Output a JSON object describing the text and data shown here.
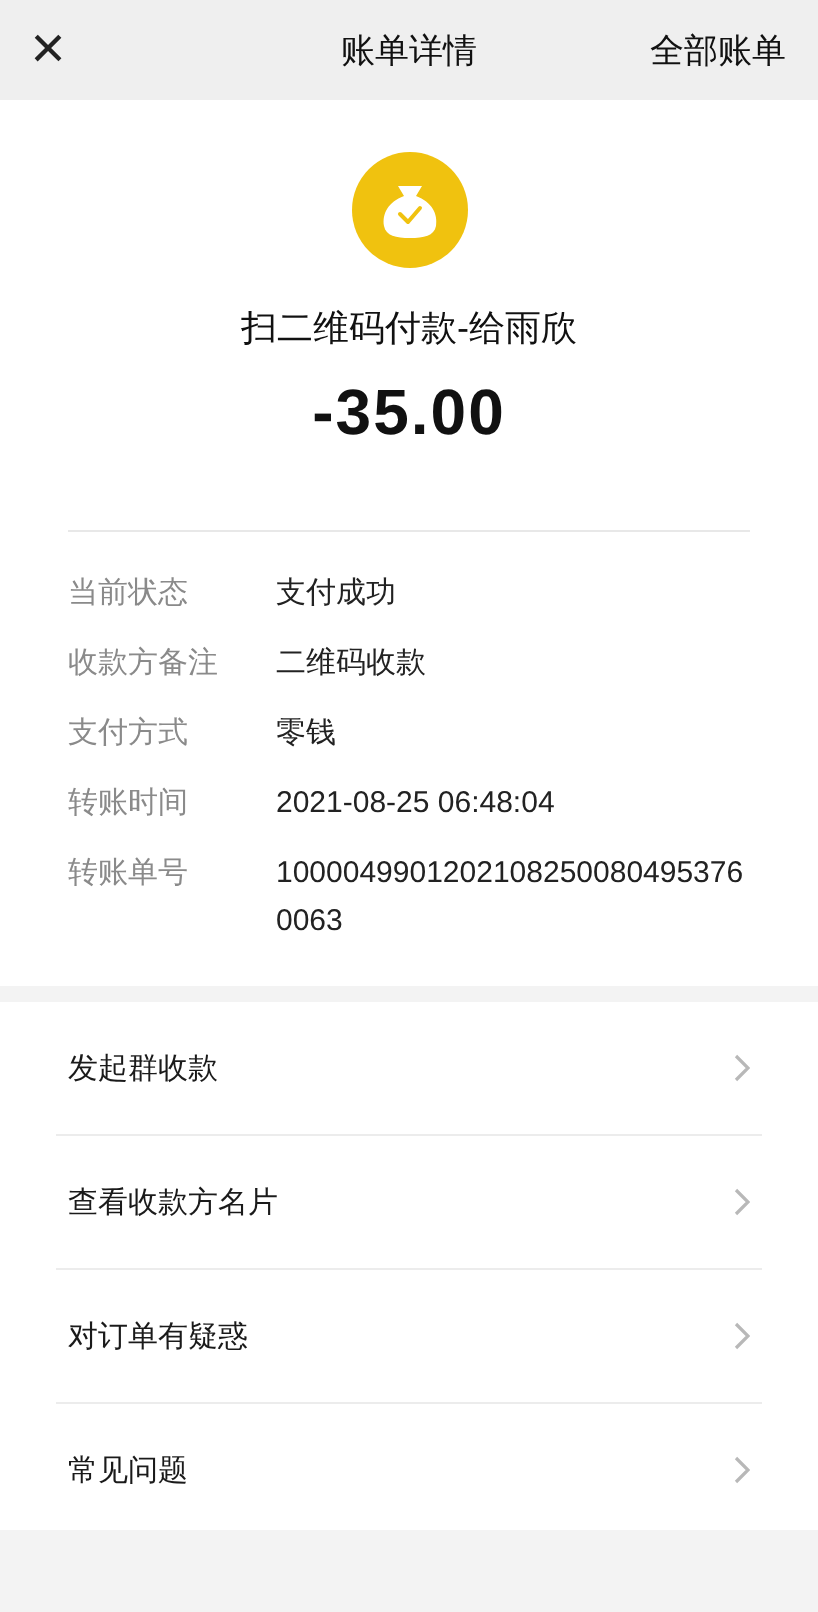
{
  "header": {
    "close": "×",
    "title": "账单详情",
    "action": "全部账单"
  },
  "summary": {
    "title": "扫二维码付款-给雨欣",
    "amount": "-35.00"
  },
  "details": [
    {
      "label": "当前状态",
      "value": "支付成功"
    },
    {
      "label": "收款方备注",
      "value": "二维码收款"
    },
    {
      "label": "支付方式",
      "value": "零钱"
    },
    {
      "label": "转账时间",
      "value": "2021-08-25 06:48:04"
    },
    {
      "label": "转账单号",
      "value": "10000499012021082500804953760063"
    }
  ],
  "menu": [
    {
      "label": "发起群收款"
    },
    {
      "label": "查看收款方名片"
    },
    {
      "label": "对订单有疑惑"
    },
    {
      "label": "常见问题"
    }
  ]
}
